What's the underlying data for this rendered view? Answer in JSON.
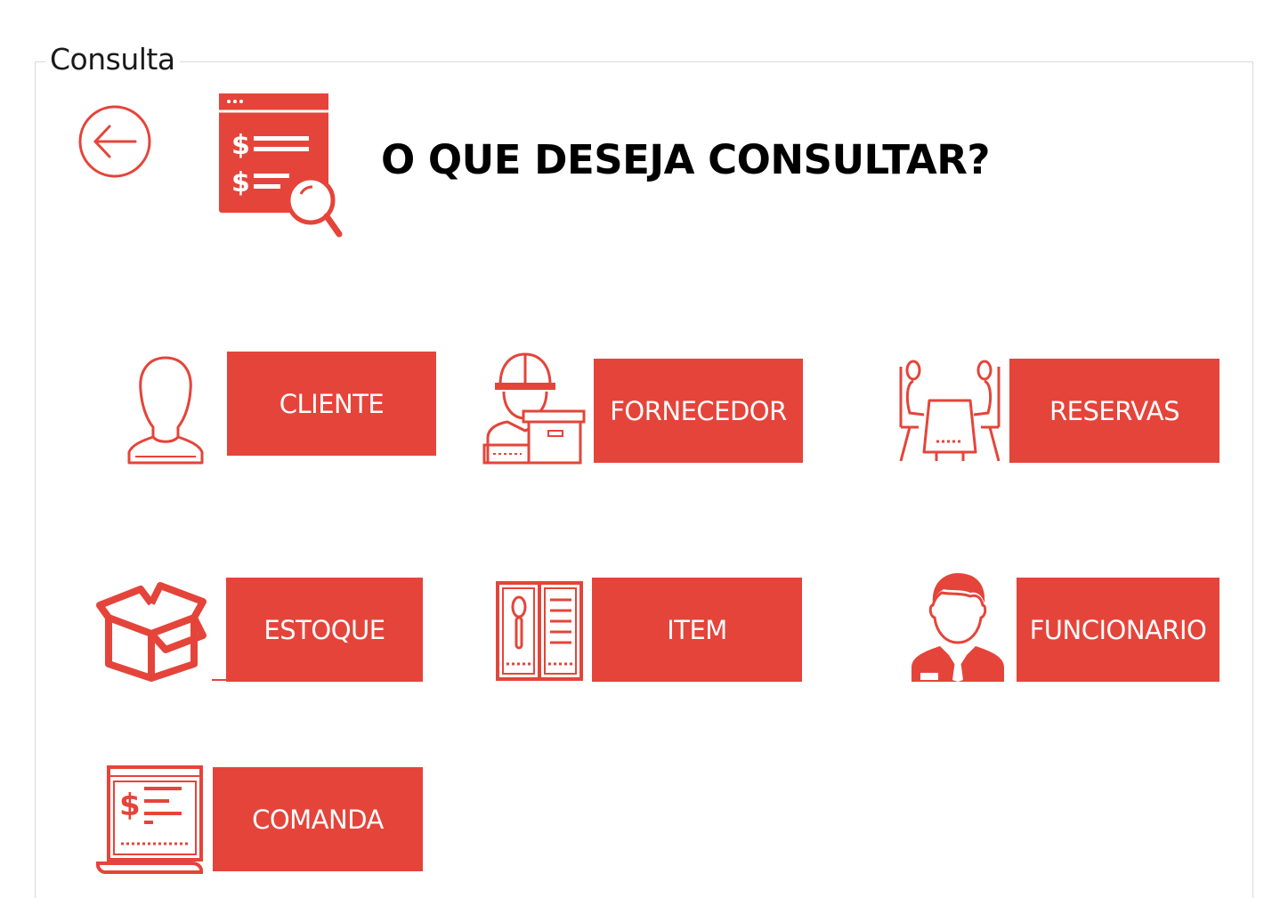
{
  "window": {
    "group_title": "Consulta"
  },
  "header": {
    "title": "O QUE DESEJA CONSULTAR?",
    "back_icon": "arrow-left-circle-icon",
    "header_icon": "financial-search-icon"
  },
  "menu": {
    "cliente": {
      "label": "CLIENTE",
      "icon": "person-silhouette-icon"
    },
    "fornecedor": {
      "label": "FORNECEDOR",
      "icon": "delivery-worker-icon"
    },
    "reservas": {
      "label": "RESERVAS",
      "icon": "dining-table-icon"
    },
    "estoque": {
      "label": "ESTOQUE",
      "icon": "open-box-icon"
    },
    "item": {
      "label": "ITEM",
      "icon": "menu-card-icon"
    },
    "funcionario": {
      "label": "FUNCIONARIO",
      "icon": "waiter-icon"
    },
    "comanda": {
      "label": "COMANDA",
      "icon": "receipt-icon"
    }
  },
  "colors": {
    "accent": "#e5443a",
    "text_on_accent": "#ffffff",
    "border": "#d9d9d9"
  }
}
